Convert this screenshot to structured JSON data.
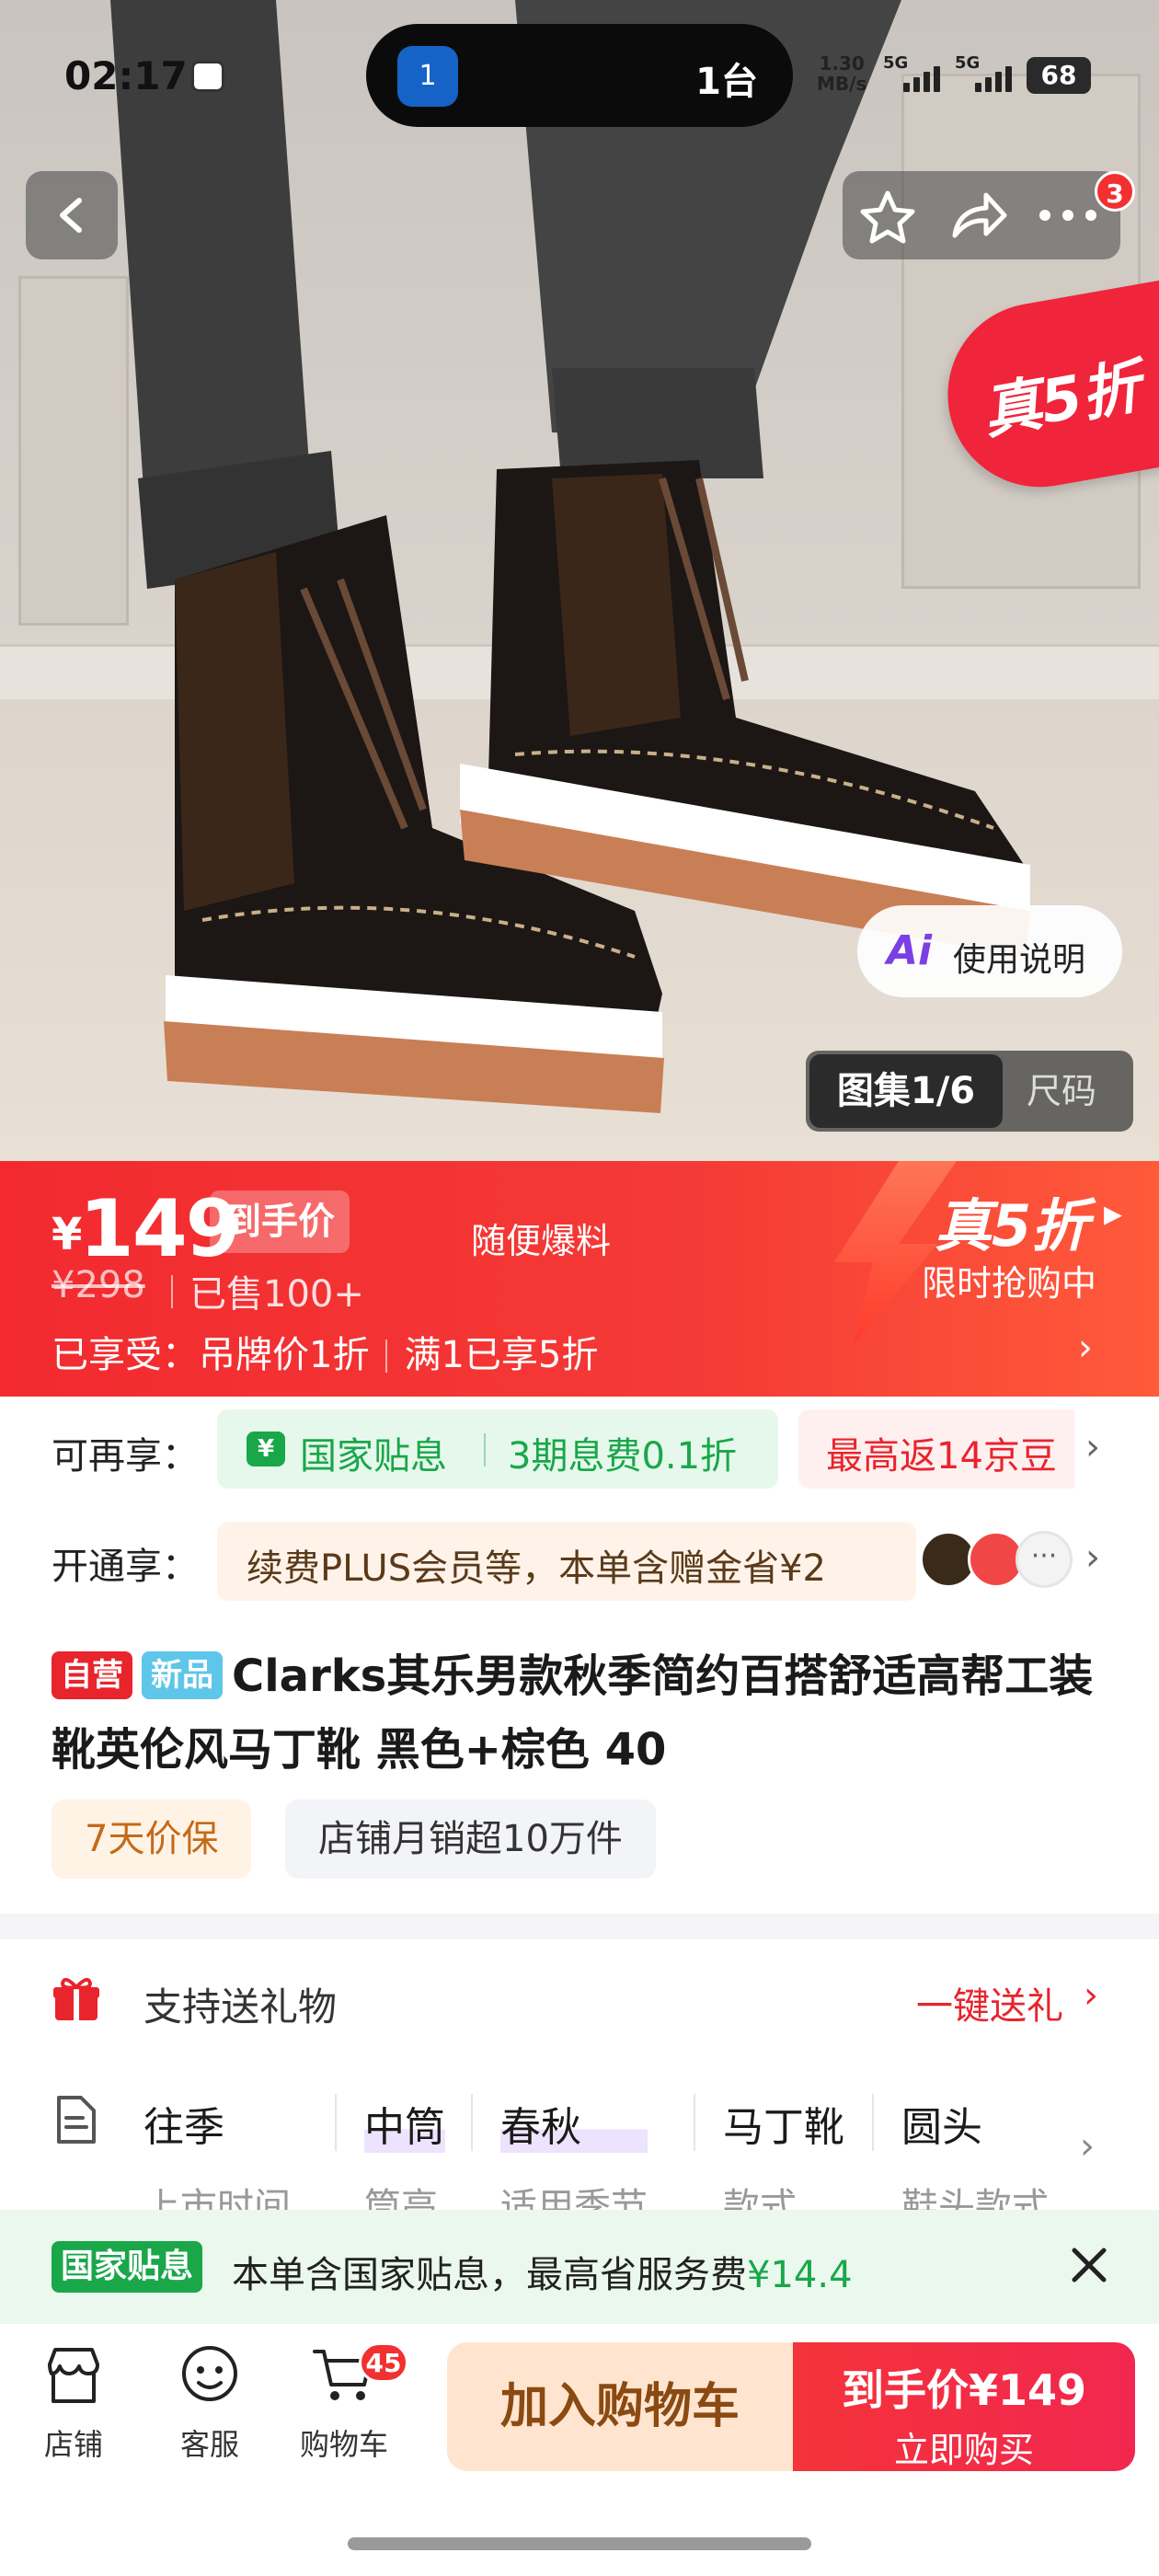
{
  "status_bar": {
    "time": "02:17",
    "island_count": "1台",
    "island_badge": "1",
    "net_speed_value": "1.30",
    "net_speed_unit": "MB/s",
    "sig1_label": "5G",
    "sig2_label": "5G",
    "battery": "68"
  },
  "hero": {
    "nav_badge": "3",
    "promo_corner": "真5折",
    "usage_ai": "Ai",
    "usage_label": "使用说明",
    "gallery_label": "图集1/6",
    "size_label": "尺码"
  },
  "price": {
    "currency": "¥",
    "amount": "149",
    "tag": "到手价",
    "random_leak": "随便爆料",
    "original": "¥298",
    "sold": "已售100+",
    "enjoy_prefix": "已享受：",
    "enjoy_item1": "吊牌价1折",
    "enjoy_item2": "满1已享5折",
    "real_off": "真5折",
    "limited": "限时抢购中"
  },
  "benefits": {
    "extra_label": "可再享：",
    "subsidy_icon": "¥",
    "subsidy_text": "国家贴息",
    "installment_text": "3期息费0.1折",
    "rebate_text": "最高返14京豆",
    "plus_label": "开通享：",
    "plus_text": "续费PLUS会员等，本单含赠金省¥2"
  },
  "product": {
    "tag_self": "自营",
    "tag_new": "新品",
    "title": "Clarks其乐男款秋季简约百搭舒适高帮工装靴英伦风马丁靴 黑色+棕色 40",
    "chip_price_protect": "7天价保",
    "chip_sales": "店铺月销超10万件"
  },
  "gift": {
    "label": "支持送礼物",
    "link": "一键送礼"
  },
  "attributes": [
    {
      "value": "往季",
      "key": "上市时间"
    },
    {
      "value": "中筒",
      "key": "筒高"
    },
    {
      "value": "春秋",
      "key": "适用季节"
    },
    {
      "value": "马丁靴",
      "key": "款式"
    },
    {
      "value": "圆头",
      "key": "鞋头款式"
    }
  ],
  "subsidy_banner": {
    "badge": "国家贴息",
    "text": "本单含国家贴息，最高省服务费",
    "amount": "¥14.4"
  },
  "bottom_bar": {
    "store": "店铺",
    "service": "客服",
    "cart": "购物车",
    "cart_count": "45",
    "add_to_cart": "加入购物车",
    "buy_price": "到手价¥149",
    "buy_now": "立即购买"
  },
  "colors": {
    "brand_red": "#f23030",
    "subsidy_green": "#19a74a",
    "plus_brown": "#5a3a1a"
  }
}
